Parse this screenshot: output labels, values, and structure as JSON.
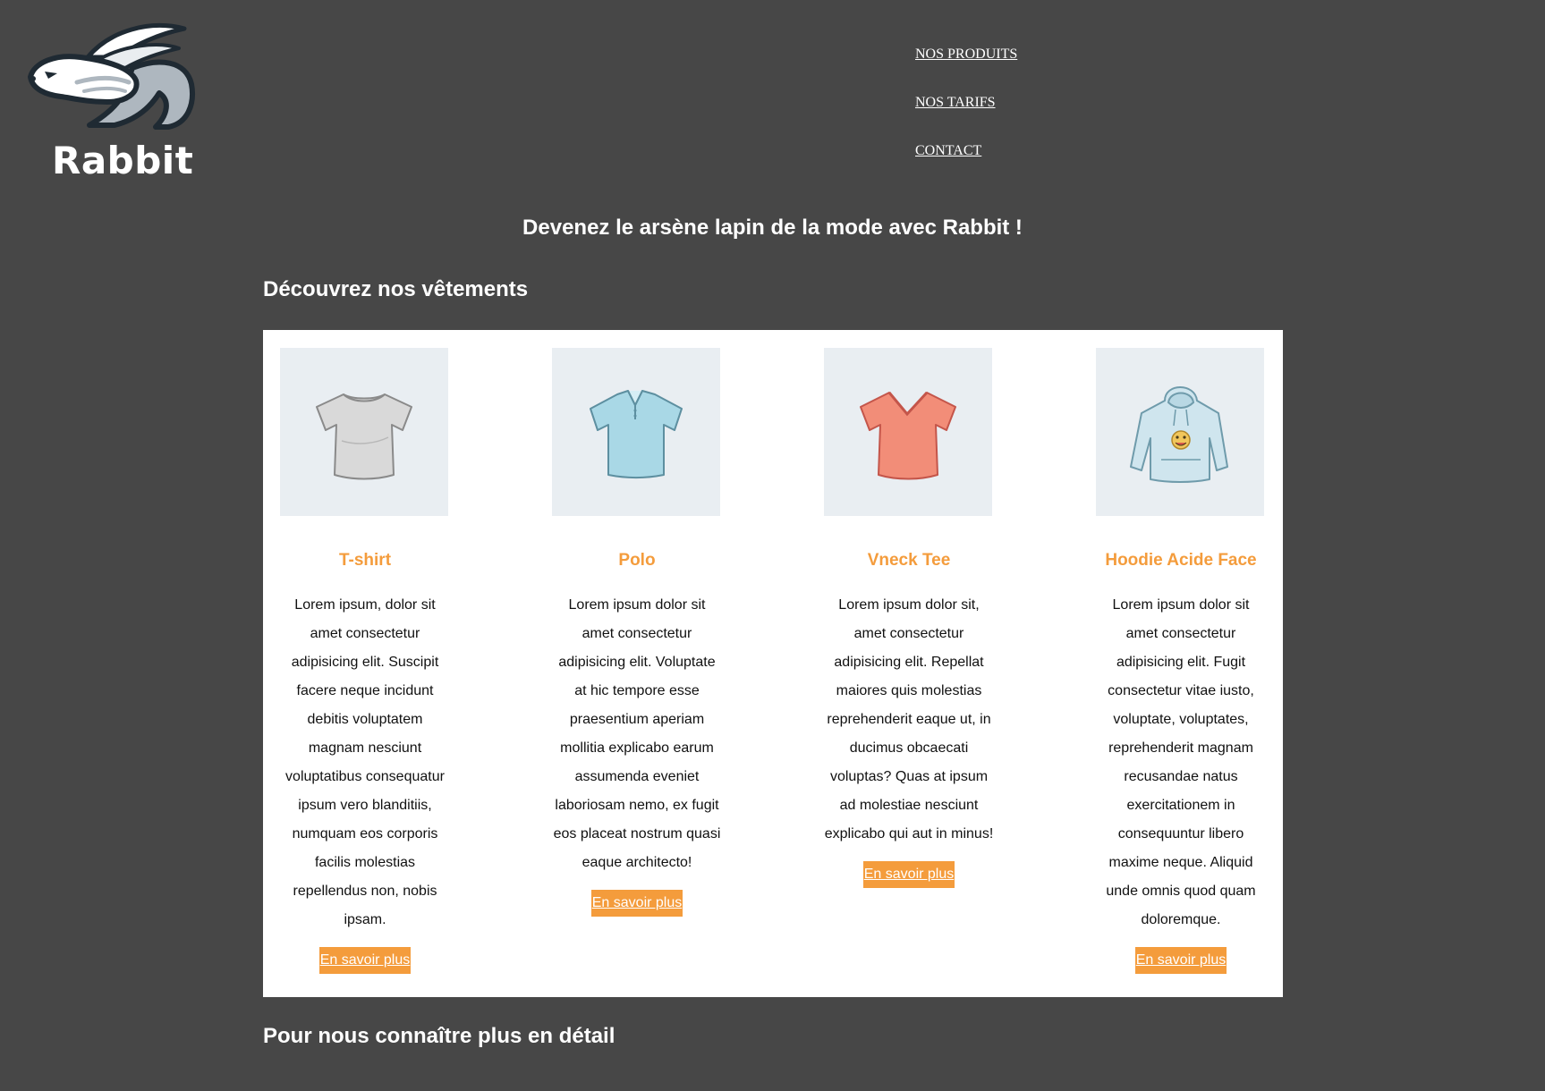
{
  "brand": {
    "name": "Rabbit"
  },
  "nav": {
    "items": [
      {
        "label": "NOS PRODUITS"
      },
      {
        "label": "NOS TARIFS"
      },
      {
        "label": "CONTACT"
      }
    ]
  },
  "hero": {
    "tagline": "Devenez le arsène lapin de la mode avec Rabbit !"
  },
  "sections": {
    "products_title": "Découvrez nos vêtements",
    "about_title": "Pour nous connaître plus en détail"
  },
  "colors": {
    "background": "#474747",
    "accent": "#f49c3c",
    "panel": "#ffffff",
    "thumb_bg": "#e9eef2"
  },
  "products": [
    {
      "name": "T-shirt",
      "icon": "tshirt-grey-icon",
      "description": "Lorem ipsum, dolor sit amet consectetur adipisicing elit. Suscipit facere neque incidunt debitis voluptatem magnam nesciunt voluptatibus consequatur ipsum vero blanditiis, numquam eos corporis facilis molestias repellendus non, nobis ipsam.",
      "button_label": "En savoir plus"
    },
    {
      "name": "Polo",
      "icon": "polo-blue-icon",
      "description": "Lorem ipsum dolor sit amet consectetur adipisicing elit. Voluptate at hic tempore esse praesentium aperiam mollitia explicabo earum assumenda eveniet laboriosam nemo, ex fugit eos placeat nostrum quasi eaque architecto!",
      "button_label": "En savoir plus"
    },
    {
      "name": "Vneck Tee",
      "icon": "vneck-coral-icon",
      "description": "Lorem ipsum dolor sit, amet consectetur adipisicing elit. Repellat maiores quis molestias reprehenderit eaque ut, in ducimus obcaecati voluptas? Quas at ipsum ad molestiae nesciunt explicabo qui aut in minus!",
      "button_label": "En savoir plus"
    },
    {
      "name": "Hoodie Acide Face",
      "icon": "hoodie-lightblue-icon",
      "description": "Lorem ipsum dolor sit amet consectetur adipisicing elit. Fugit consectetur vitae iusto, voluptate, voluptates, reprehenderit magnam recusandae natus exercitationem in consequuntur libero maxime neque. Aliquid unde omnis quod quam doloremque.",
      "button_label": "En savoir plus"
    }
  ]
}
